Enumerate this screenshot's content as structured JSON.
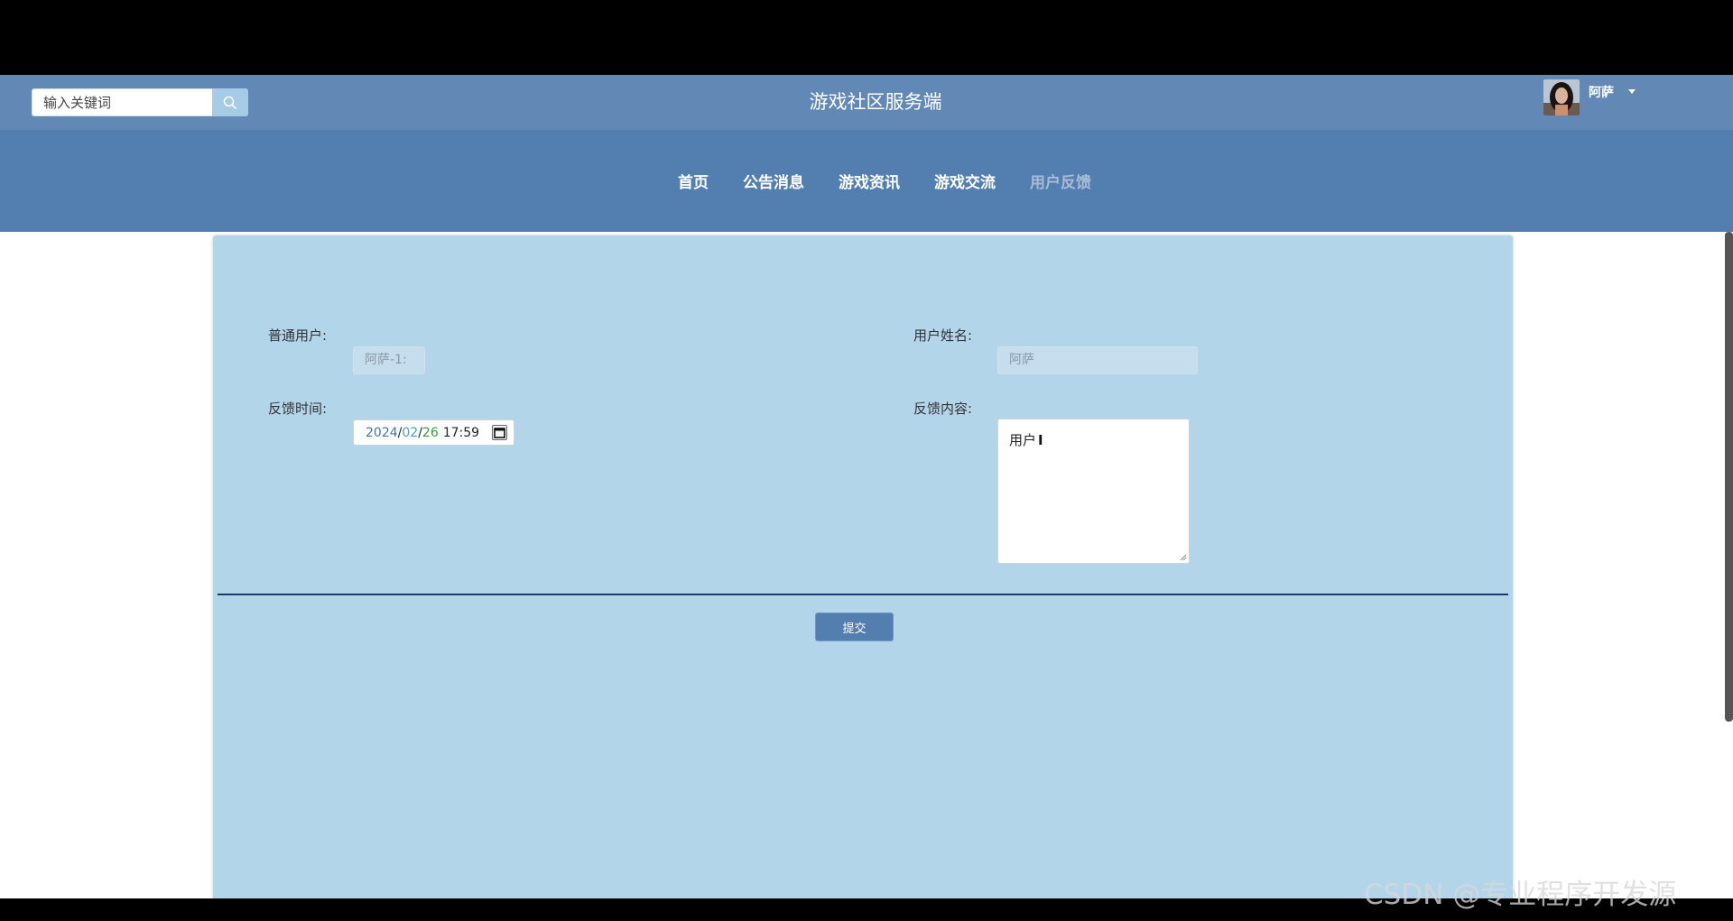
{
  "header": {
    "search_placeholder": "输入关键词",
    "site_title": "游戏社区服务端",
    "user_name": "阿萨"
  },
  "nav": {
    "items": [
      {
        "label": "首页",
        "active": false
      },
      {
        "label": "公告消息",
        "active": false
      },
      {
        "label": "游戏资讯",
        "active": false
      },
      {
        "label": "游戏交流",
        "active": false
      },
      {
        "label": "用户反馈",
        "active": true
      }
    ]
  },
  "form": {
    "user_label": "普通用户:",
    "user_value": "阿萨-1:",
    "name_label": "用户姓名:",
    "name_value": "阿萨",
    "time_label": "反馈时间:",
    "time_year": "2024",
    "time_month": "02",
    "time_day": "26",
    "time_clock": "17:59",
    "content_label": "反馈内容:",
    "content_value": "用户",
    "submit_label": "提交"
  },
  "watermark": "CSDN @专业程序开发源",
  "colors": {
    "header": "#6289b6",
    "navbar": "#527eb0",
    "panel": "#b3d5ea",
    "divider": "#1e3a6b"
  }
}
